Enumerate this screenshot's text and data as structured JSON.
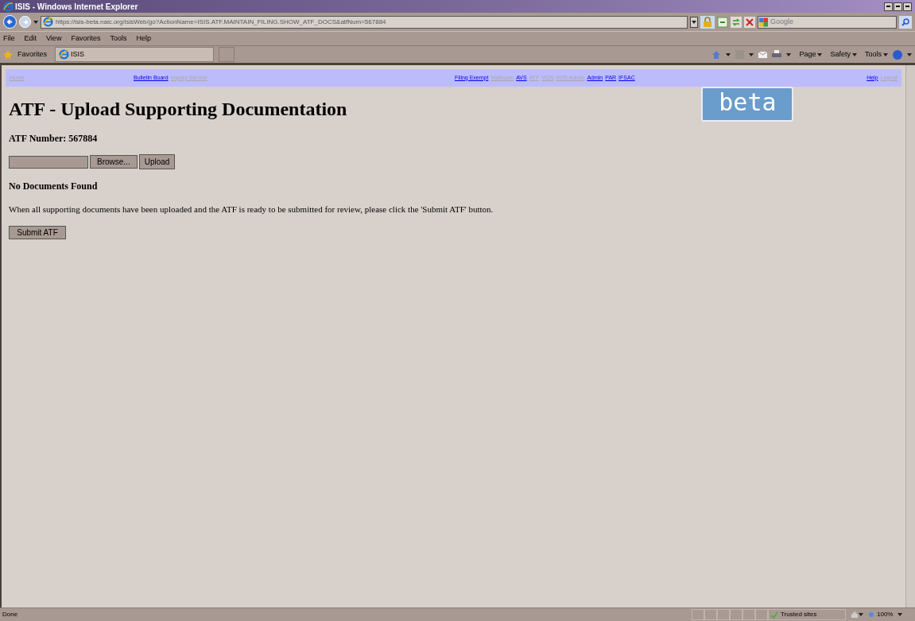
{
  "window": {
    "title": "ISIS - Windows Internet Explorer"
  },
  "address_bar": {
    "url": "https://isis-beta.naic.org/isisWeb/go?ActionName=ISIS.ATF.MAINTAIN_FILING.SHOW_ATF_DOCS&atfNum=567884"
  },
  "search": {
    "placeholder": "Google"
  },
  "menu": [
    "File",
    "Edit",
    "View",
    "Favorites",
    "Tools",
    "Help"
  ],
  "favorites_bar": {
    "label": "Favorites",
    "tabs": [
      {
        "label": "ISIS",
        "selected": true
      }
    ]
  },
  "command_bar": [
    "Page",
    "Safety",
    "Tools"
  ],
  "nav": {
    "left": [
      {
        "label": "Home",
        "disabled": true
      }
    ],
    "center_left": [
      {
        "label": "Bulletin Board",
        "disabled": false
      },
      {
        "label": "Inquiry Service",
        "disabled": true
      }
    ],
    "center": [
      {
        "label": "Filing Exempt",
        "disabled": false
      },
      {
        "label": "Mailroom",
        "disabled": true
      },
      {
        "label": "AVS",
        "disabled": false
      },
      {
        "label": "ATF",
        "disabled": true
      },
      {
        "label": "VOS",
        "disabled": true
      },
      {
        "label": "VOS Admin",
        "disabled": true
      },
      {
        "label": "Admin",
        "disabled": false
      },
      {
        "label": "PAR",
        "disabled": false
      },
      {
        "label": "IFSAC",
        "disabled": false
      }
    ],
    "right": [
      {
        "label": "Help",
        "disabled": false
      },
      {
        "label": "Logout",
        "disabled": true
      }
    ]
  },
  "beta_badge": "beta",
  "page": {
    "heading": "ATF - Upload Supporting Documentation",
    "atf_number": "ATF Number: 567884",
    "browse_button": "Browse...",
    "upload_button": "Upload",
    "no_documents": "No Documents Found",
    "instructions": "When all supporting documents have been uploaded and the ATF is ready to be submitted for review, please click the 'Submit ATF' button.",
    "submit_button": "Submit ATF"
  },
  "status_bar": {
    "status": "Done",
    "zone": "Trusted sites",
    "zoom": "100%"
  }
}
